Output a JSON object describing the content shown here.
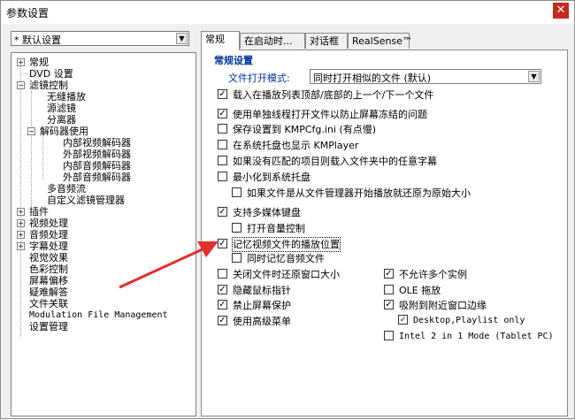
{
  "window": {
    "title": "参数设置",
    "close_icon": "✕"
  },
  "profile": {
    "value": "* 默认设置"
  },
  "tree": {
    "items": [
      {
        "label": "常规",
        "expander": "+"
      },
      {
        "label": "DVD 设置"
      },
      {
        "label": "滤镜控制",
        "expander": "−"
      },
      {
        "label": "无缝播放"
      },
      {
        "label": "源滤镜"
      },
      {
        "label": "分离器"
      },
      {
        "label": "解码器使用",
        "expander": "−"
      },
      {
        "label": "内部视频解码器"
      },
      {
        "label": "外部视频解码器"
      },
      {
        "label": "内部音频解码器"
      },
      {
        "label": "外部音频解码器"
      },
      {
        "label": "多音频流"
      },
      {
        "label": "自定义滤镜管理器"
      },
      {
        "label": "插件",
        "expander": "+"
      },
      {
        "label": "视频处理",
        "expander": "+"
      },
      {
        "label": "音频处理",
        "expander": "+"
      },
      {
        "label": "字幕处理",
        "expander": "+"
      },
      {
        "label": "视觉效果"
      },
      {
        "label": "色彩控制"
      },
      {
        "label": "屏幕偏移"
      },
      {
        "label": "疑难解答"
      },
      {
        "label": "文件关联"
      },
      {
        "label": "Modulation File Management"
      },
      {
        "label": "设置管理"
      }
    ]
  },
  "tabs": [
    {
      "label": "常规"
    },
    {
      "label": "在启动时..."
    },
    {
      "label": "对话框"
    },
    {
      "label": "RealSense™"
    }
  ],
  "general": {
    "section_title": "常规设置",
    "file_open_mode_label": "文件打开模式:",
    "file_open_mode_value": "同时打开相似的文件 (默认)",
    "options": [
      {
        "label": "载入在播放列表顶部/底部的上一个/下一个文件",
        "checked": "✓"
      },
      {
        "label": "使用单独线程打开文件以防止屏幕冻结的问题",
        "checked": "✓"
      },
      {
        "label": "保存设置到 KMPCfg.ini (有点慢)",
        "checked": ""
      },
      {
        "label": "在系统托盘也显示 KMPlayer",
        "checked": ""
      },
      {
        "label": "如果没有匹配的项目则载入文件夹中的任意字幕",
        "checked": ""
      },
      {
        "label": "最小化到系统托盘",
        "checked": ""
      },
      {
        "label": "如果文件是从文件管理器开始播放就还原为原始大小",
        "checked": ""
      },
      {
        "label": "支持多媒体键盘",
        "checked": "✓"
      },
      {
        "label": "打开音量控制",
        "checked": ""
      },
      {
        "label": "记忆视频文件的播放位置",
        "checked": "✓"
      },
      {
        "label": "同时记忆音频文件",
        "checked": ""
      },
      {
        "label": "关闭文件时还原窗口大小",
        "checked": ""
      },
      {
        "label": "隐藏鼠标指针",
        "checked": "✓"
      },
      {
        "label": "禁止屏幕保护",
        "checked": "✓"
      },
      {
        "label": "使用高级菜单",
        "checked": "✓"
      },
      {
        "label": "不允许多个实例",
        "checked": "✓"
      },
      {
        "label": "OLE 拖放",
        "checked": ""
      },
      {
        "label": "吸附到附近窗口边缘",
        "checked": "✓"
      },
      {
        "label": "Desktop,Playlist only",
        "checked": "✓"
      },
      {
        "label": "Intel 2 in 1 Mode (Tablet PC)",
        "checked": ""
      }
    ]
  },
  "annotation_color": "#e03030"
}
